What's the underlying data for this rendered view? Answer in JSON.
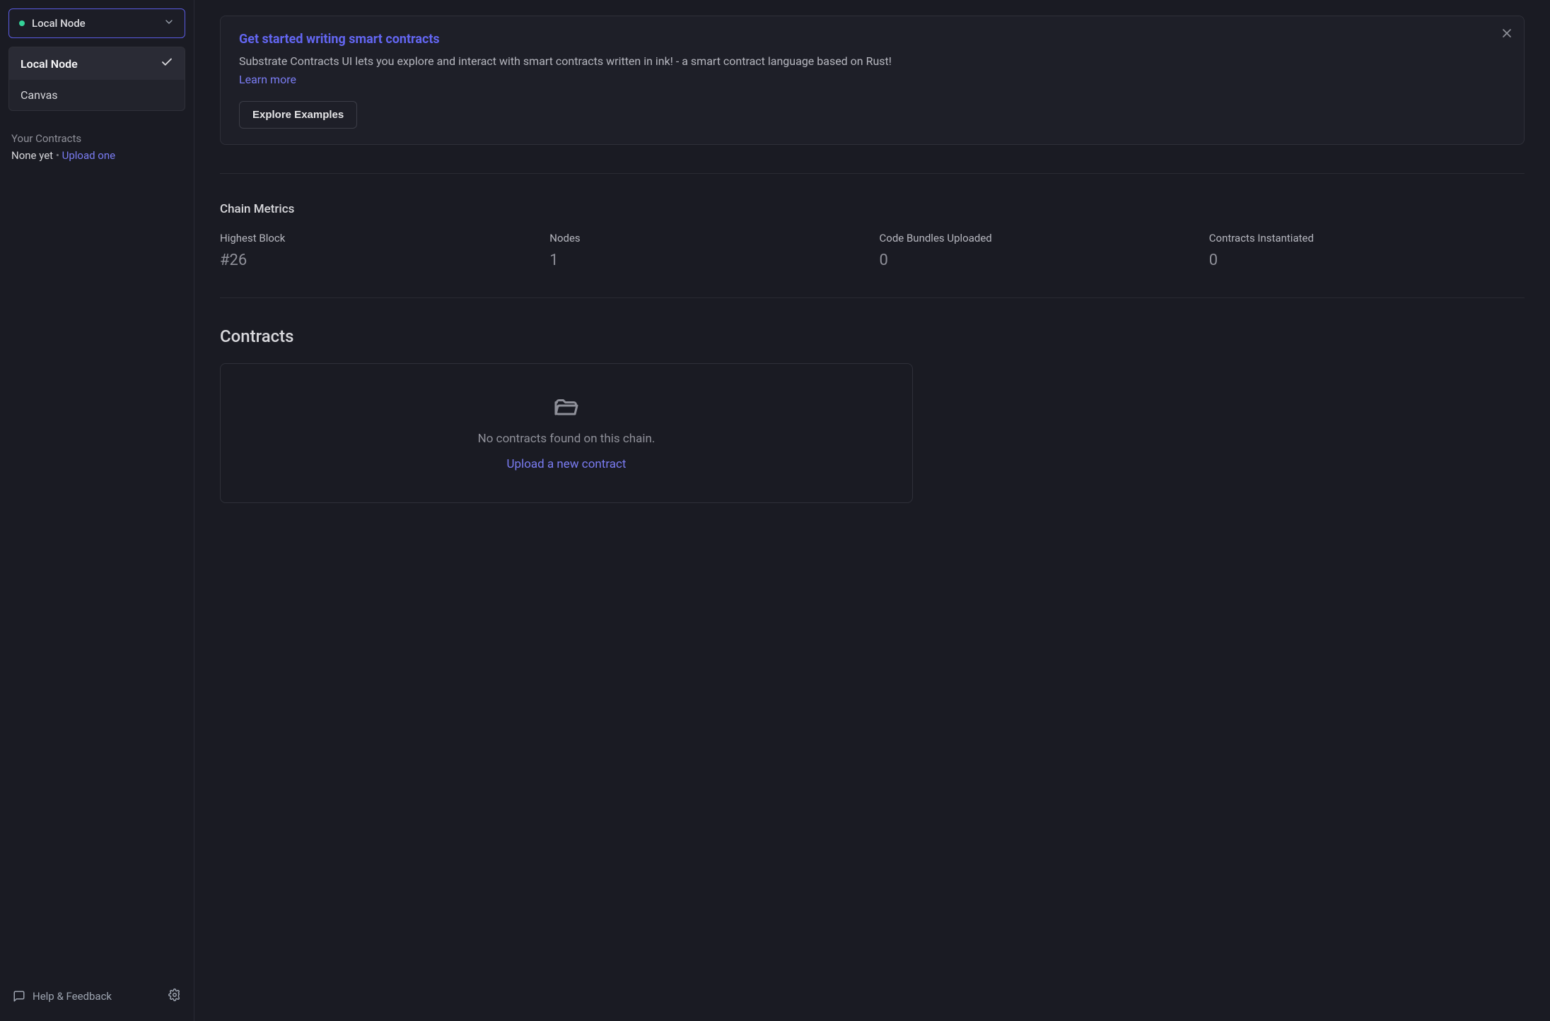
{
  "sidebar": {
    "network_selected": "Local Node",
    "dropdown": [
      {
        "label": "Local Node",
        "selected": true
      },
      {
        "label": "Canvas",
        "selected": false
      }
    ],
    "contracts_title": "Your Contracts",
    "contracts_empty": "None yet",
    "contracts_sep": "•",
    "contracts_upload": "Upload one",
    "help_label": "Help & Feedback"
  },
  "banner": {
    "title": "Get started writing smart contracts",
    "text": "Substrate Contracts UI lets you explore and interact with smart contracts written in ink! - a smart contract language based on Rust! ",
    "learn_more": "Learn more",
    "explore_btn": "Explore Examples"
  },
  "metrics": {
    "title": "Chain Metrics",
    "items": [
      {
        "label": "Highest Block",
        "value": "#26"
      },
      {
        "label": "Nodes",
        "value": "1"
      },
      {
        "label": "Code Bundles Uploaded",
        "value": "0"
      },
      {
        "label": "Contracts Instantiated",
        "value": "0"
      }
    ]
  },
  "contracts": {
    "title": "Contracts",
    "empty_text": "No contracts found on this chain.",
    "upload_link": "Upload a new contract"
  }
}
